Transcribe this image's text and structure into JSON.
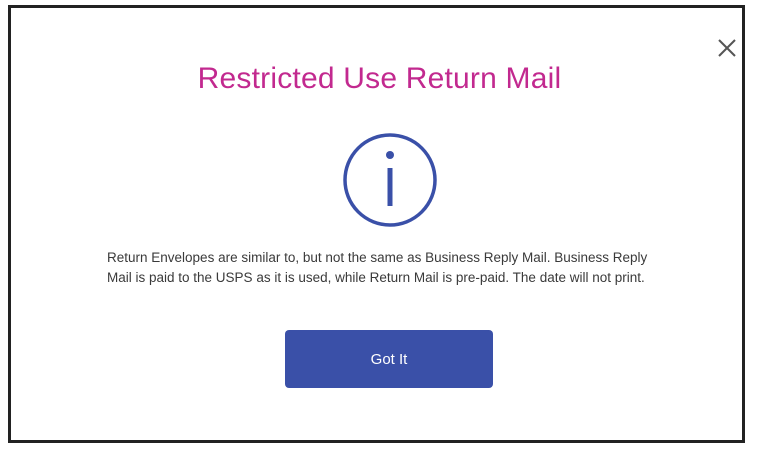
{
  "dialog": {
    "title": "Restricted Use Return Mail",
    "message": "Return Envelopes are similar to, but not the same as Business Reply Mail. Business Reply Mail is paid to the USPS as it is used, while Return Mail is pre-paid. The date will not print.",
    "confirm_label": "Got It",
    "close_icon": "close-icon",
    "info_icon": "info-icon"
  },
  "colors": {
    "title": "#c2298f",
    "icon": "#3a50a8",
    "button": "#3a50a8",
    "close": "#555555"
  }
}
